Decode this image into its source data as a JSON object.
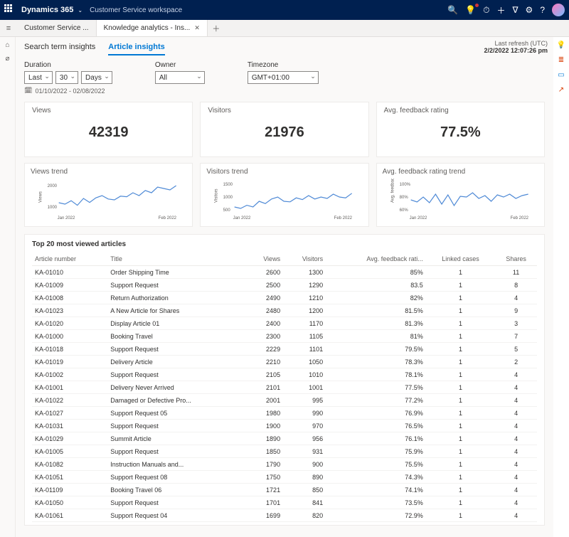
{
  "topbar": {
    "brand": "Dynamics 365",
    "workspace": "Customer Service workspace"
  },
  "tabs": {
    "items": [
      {
        "label": "Customer Service ...",
        "active": false
      },
      {
        "label": "Knowledge analytics - Ins...",
        "active": true
      }
    ]
  },
  "meta": {
    "refresh_label": "Last refresh (UTC)",
    "refresh_time": "2/2/2022 12:07:26 pm"
  },
  "page_tabs": {
    "search": "Search term insights",
    "article": "Article insights"
  },
  "filters": {
    "duration_label": "Duration",
    "duration_mode": "Last",
    "duration_n": "30",
    "duration_unit": "Days",
    "owner_label": "Owner",
    "owner_value": "All",
    "tz_label": "Timezone",
    "tz_value": "GMT+01:00",
    "date_range": "01/10/2022 - 02/08/2022"
  },
  "kpi": {
    "views_label": "Views",
    "views_value": "42319",
    "visitors_label": "Visitors",
    "visitors_value": "21976",
    "feedback_label": "Avg. feedback rating",
    "feedback_value": "77.5%"
  },
  "trends": {
    "views_label": "Views trend",
    "visitors_label": "Visitors trend",
    "feedback_label": "Avg. feedback rating trend",
    "x_start": "Jan 2022",
    "x_end": "Feb 2022",
    "views_y": [
      "1000",
      "2000"
    ],
    "visitors_y": [
      "500",
      "1000",
      "1500"
    ],
    "feedback_y": [
      "60%",
      "80%",
      "100%"
    ],
    "views_axis_title": "Views",
    "visitors_axis_title": "Visitors",
    "feedback_axis_title": "Avg. feedback rating"
  },
  "chart_data": [
    {
      "type": "line",
      "title": "Views trend",
      "xlabel": "",
      "ylabel": "Views",
      "ylim": [
        1000,
        2000
      ],
      "x_range": "Jan 2022 – Feb 2022",
      "values": [
        1350,
        1300,
        1420,
        1260,
        1500,
        1360,
        1520,
        1600,
        1480,
        1450,
        1580,
        1560,
        1700,
        1600,
        1780,
        1700,
        1900,
        1850,
        1800,
        1950
      ]
    },
    {
      "type": "line",
      "title": "Visitors trend",
      "xlabel": "",
      "ylabel": "Visitors",
      "ylim": [
        500,
        1500
      ],
      "x_range": "Jan 2022 – Feb 2022",
      "values": [
        700,
        650,
        760,
        700,
        900,
        820,
        980,
        1050,
        900,
        880,
        1020,
        960,
        1100,
        980,
        1050,
        1000,
        1150,
        1050,
        1020,
        1180
      ]
    },
    {
      "type": "line",
      "title": "Avg. feedback rating trend",
      "xlabel": "",
      "ylabel": "Avg. feedback rating",
      "ylim": [
        60,
        100
      ],
      "x_range": "Jan 2022 – Feb 2022",
      "values": [
        78,
        75,
        82,
        74,
        86,
        72,
        85,
        70,
        83,
        82,
        88,
        80,
        84,
        76,
        85,
        82,
        86,
        80,
        84,
        86
      ]
    }
  ],
  "table": {
    "title": "Top 20 most viewed articles",
    "cols": {
      "article": "Article number",
      "title": "Title",
      "views": "Views",
      "visitors": "Visitors",
      "feedback": "Avg. feedback rati...",
      "linked": "Linked cases",
      "shares": "Shares"
    },
    "rows": [
      {
        "a": "KA-01010",
        "t": "Order Shipping Time",
        "v": "2600",
        "vi": "1300",
        "f": "85%",
        "l": "1",
        "s": "11"
      },
      {
        "a": "KA-01009",
        "t": "Support Request",
        "v": "2500",
        "vi": "1290",
        "f": "83.5",
        "l": "1",
        "s": "8"
      },
      {
        "a": "KA-01008",
        "t": "Return Authorization",
        "v": "2490",
        "vi": "1210",
        "f": "82%",
        "l": "1",
        "s": "4"
      },
      {
        "a": "KA-01023",
        "t": "A New Article for Shares",
        "v": "2480",
        "vi": "1200",
        "f": "81.5%",
        "l": "1",
        "s": "9"
      },
      {
        "a": "KA-01020",
        "t": "Display Article 01",
        "v": "2400",
        "vi": "1170",
        "f": "81.3%",
        "l": "1",
        "s": "3"
      },
      {
        "a": "KA-01000",
        "t": "Booking Travel",
        "v": "2300",
        "vi": "1105",
        "f": "81%",
        "l": "1",
        "s": "7"
      },
      {
        "a": "KA-01018",
        "t": "Support Request",
        "v": "2229",
        "vi": "1101",
        "f": "79.5%",
        "l": "1",
        "s": "5"
      },
      {
        "a": "KA-01019",
        "t": "Delivery Article",
        "v": "2210",
        "vi": "1050",
        "f": "78.3%",
        "l": "1",
        "s": "2"
      },
      {
        "a": "KA-01002",
        "t": "Support Request",
        "v": "2105",
        "vi": "1010",
        "f": "78.1%",
        "l": "1",
        "s": "4"
      },
      {
        "a": "KA-01001",
        "t": "Delivery Never Arrived",
        "v": "2101",
        "vi": "1001",
        "f": "77.5%",
        "l": "1",
        "s": "4"
      },
      {
        "a": "KA-01022",
        "t": "Damaged or Defective Pro...",
        "v": "2001",
        "vi": "995",
        "f": "77.2%",
        "l": "1",
        "s": "4"
      },
      {
        "a": "KA-01027",
        "t": "Support Request 05",
        "v": "1980",
        "vi": "990",
        "f": "76.9%",
        "l": "1",
        "s": "4"
      },
      {
        "a": "KA-01031",
        "t": "Support Request",
        "v": "1900",
        "vi": "970",
        "f": "76.5%",
        "l": "1",
        "s": "4"
      },
      {
        "a": "KA-01029",
        "t": "Summit Article",
        "v": "1890",
        "vi": "956",
        "f": "76.1%",
        "l": "1",
        "s": "4"
      },
      {
        "a": "KA-01005",
        "t": "Support Request",
        "v": "1850",
        "vi": "931",
        "f": "75.9%",
        "l": "1",
        "s": "4"
      },
      {
        "a": "KA-01082",
        "t": "Instruction Manuals and...",
        "v": "1790",
        "vi": "900",
        "f": "75.5%",
        "l": "1",
        "s": "4"
      },
      {
        "a": "KA-01051",
        "t": "Support Request 08",
        "v": "1750",
        "vi": "890",
        "f": "74.3%",
        "l": "1",
        "s": "4"
      },
      {
        "a": "KA-01109",
        "t": "Booking Travel 06",
        "v": "1721",
        "vi": "850",
        "f": "74.1%",
        "l": "1",
        "s": "4"
      },
      {
        "a": "KA-01050",
        "t": "Support Request",
        "v": "1701",
        "vi": "841",
        "f": "73.5%",
        "l": "1",
        "s": "4"
      },
      {
        "a": "KA-01061",
        "t": "Support Request 04",
        "v": "1699",
        "vi": "820",
        "f": "72.9%",
        "l": "1",
        "s": "4"
      }
    ]
  }
}
